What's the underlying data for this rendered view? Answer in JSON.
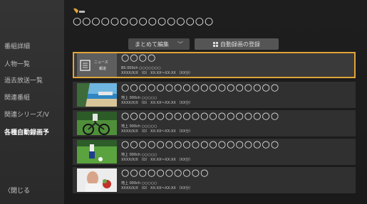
{
  "sidebar": {
    "items": [
      {
        "label": "番組詳細"
      },
      {
        "label": "人物一覧"
      },
      {
        "label": "過去放送一覧"
      },
      {
        "label": "関連番組"
      },
      {
        "label": "関連シリーズ/V"
      },
      {
        "label": "各種自動録画予"
      }
    ],
    "back_label": "〈閉じる"
  },
  "header": {
    "title": "○○○○○○○○○○○○○○○"
  },
  "toolbar": {
    "bulk_edit_label": "まとめて編集",
    "register_label": "自動録画の登録"
  },
  "news_thumb": {
    "label": "ニュース",
    "sub": "報道"
  },
  "rows": [
    {
      "title": "○○○○",
      "line1": "BS 000ch ○○○○○○○",
      "line2": "XXXX/X/X （O） XX:XX～XX:XX （XX分）"
    },
    {
      "title": "○○○○○○○○○○○○○○○○○○",
      "line1": "地上 000ch ○○○○○",
      "line2": "XXXX/X/X （O） XX:XX～XX:XX （XX分）"
    },
    {
      "title": "○○○○○○○○○○○○○○○○○○",
      "line1": "地上 000ch ○○○○○",
      "line2": "XXXX/X/X （O） XX:XX～XX:XX （XX分）"
    },
    {
      "title": "○○○○○○○○○○○○○○○○○○",
      "line1": "地上 000ch ○○○○○",
      "line2": "XXXX/X/X （O） XX:XX～XX:XX （XX分）"
    },
    {
      "title": "○○○○○○○○○○",
      "line1": "地上 000ch ○○○○○",
      "line2": "XXXX/X/X （O） XX:XX～XX:XX （XX分）"
    }
  ],
  "colors": {
    "selection": "#e0a43a",
    "background": "#1e1e1e",
    "sidebar": "#333333"
  }
}
